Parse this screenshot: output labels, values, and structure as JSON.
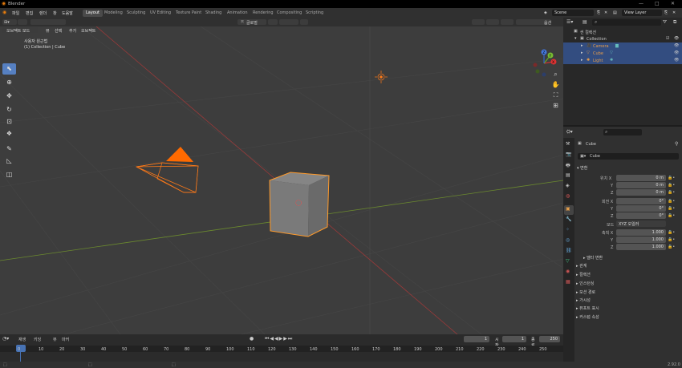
{
  "window": {
    "title": "Blender",
    "minimize": "—",
    "maximize": "□",
    "close": "✕"
  },
  "menu": [
    "파일",
    "편집",
    "렌더",
    "창",
    "도움말"
  ],
  "workspaces": [
    "Layout",
    "Modeling",
    "Sculpting",
    "UV Editing",
    "Texture Paint",
    "Shading",
    "Animation",
    "Rendering",
    "Compositing",
    "Scripting"
  ],
  "active_workspace": "Layout",
  "scene": "Scene",
  "view_layer": "View Layer",
  "viewport": {
    "mode": "오브젝트 모드",
    "menus": [
      "뷰",
      "선택",
      "추가",
      "오브젝트"
    ],
    "transform_orientation": "글로벌",
    "options": "옵션",
    "view_name": "사용자 원근법",
    "collection_info": "(1) Collection | Cube"
  },
  "gizmo": {
    "x": "X",
    "y": "Y",
    "z": "Z"
  },
  "outliner": {
    "root": "씬 컬렉션",
    "collection": "Collection",
    "items": [
      {
        "name": "Camera",
        "color": "#e89d4a"
      },
      {
        "name": "Cube",
        "color": "#e89d4a"
      },
      {
        "name": "Light",
        "color": "#e89d4a"
      }
    ]
  },
  "properties": {
    "object_name": "Cube",
    "data_name": "Cube",
    "transform_header": "변환",
    "location_label": "위치 X",
    "rotation_label": "회전 X",
    "scale_label": "축척 X",
    "axis_y": "Y",
    "axis_z": "Z",
    "location": [
      "0 m",
      "0 m",
      "0 m"
    ],
    "rotation": [
      "0°",
      "0°",
      "0°"
    ],
    "mode_label": "모드",
    "rotation_mode": "XYZ 오일러",
    "scale": [
      "1.000",
      "1.000",
      "1.000"
    ],
    "delta_transform": "델타 변환",
    "sections": [
      "관계",
      "컬렉션",
      "인스턴싱",
      "모션 경로",
      "가시성",
      "뷰포트 표시",
      "커스텀 속성"
    ]
  },
  "timeline": {
    "menus": [
      "재생",
      "키잉",
      "뷰",
      "마커"
    ],
    "current_frame": "1",
    "start_label": "시작",
    "start": "1",
    "end_label": "종료",
    "end": "250",
    "ticks": [
      "0",
      "10",
      "20",
      "30",
      "40",
      "50",
      "60",
      "70",
      "80",
      "90",
      "100",
      "110",
      "120",
      "130",
      "140",
      "150",
      "160",
      "170",
      "180",
      "190",
      "200",
      "210",
      "220",
      "230",
      "240",
      "250"
    ]
  },
  "status": {
    "version": "2.92.0"
  },
  "colors": {
    "accent": "#5680c2",
    "selected": "#334d80",
    "orange": "#ff7a18",
    "x_axis": "#b03030",
    "y_axis": "#6b9a2a"
  }
}
